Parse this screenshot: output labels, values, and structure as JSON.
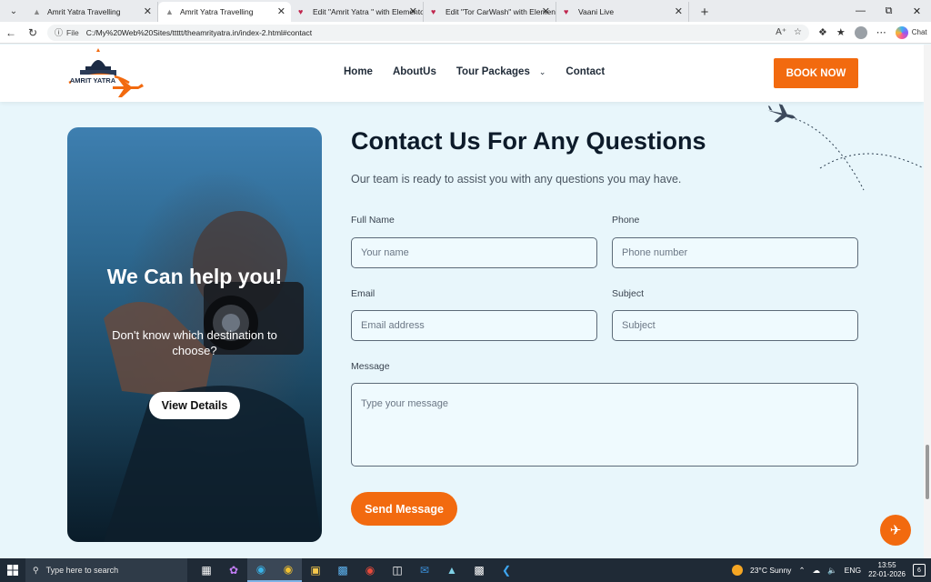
{
  "browser": {
    "tabs": [
      {
        "title": "Amrit Yatra Travelling",
        "active": false,
        "favicon": "site-icon"
      },
      {
        "title": "Amrit Yatra Travelling",
        "active": true,
        "favicon": "site-icon"
      },
      {
        "title": "Edit \"Amrit Yatra \" with Elementor",
        "active": false,
        "favicon": "elementor-icon"
      },
      {
        "title": "Edit \"Tor CarWash\" with Elementor",
        "active": false,
        "favicon": "elementor-icon"
      },
      {
        "title": "Vaani Live",
        "active": false,
        "favicon": "vaani-icon"
      }
    ],
    "address": {
      "scheme_label": "File",
      "url": "C:/My%20Web%20Sites/ttttt/theamrityatra.in/index-2.html#contact"
    },
    "chat_label": "Chat"
  },
  "site": {
    "logo_text": "AMRIT YATRA",
    "nav": [
      {
        "label": "Home"
      },
      {
        "label": "AboutUs"
      },
      {
        "label": "Tour Packages",
        "has_dropdown": true
      },
      {
        "label": "Contact"
      }
    ],
    "book_now": "BOOK NOW"
  },
  "promo": {
    "title": "We Can help you!",
    "subtitle": "Don't know which destination to choose?",
    "button": "View Details"
  },
  "contact": {
    "title": "Contact Us For Any Questions",
    "subtitle": "Our team is ready to assist you with any questions you may have.",
    "fields": {
      "full_name": {
        "label": "Full Name",
        "placeholder": "Your name"
      },
      "phone": {
        "label": "Phone",
        "placeholder": "Phone number"
      },
      "email": {
        "label": "Email",
        "placeholder": "Email address"
      },
      "subject": {
        "label": "Subject",
        "placeholder": "Subject"
      },
      "message": {
        "label": "Message",
        "placeholder": "Type your message"
      }
    },
    "submit": "Send Message"
  },
  "taskbar": {
    "search_placeholder": "Type here to search",
    "weather": "23°C  Sunny",
    "language": "ENG",
    "time": "13:55",
    "date": "22-01-2026",
    "notification_count": "6"
  },
  "colors": {
    "accent": "#f26a0f",
    "page_bg": "#e8f6fb",
    "heading": "#0d1b2a"
  }
}
